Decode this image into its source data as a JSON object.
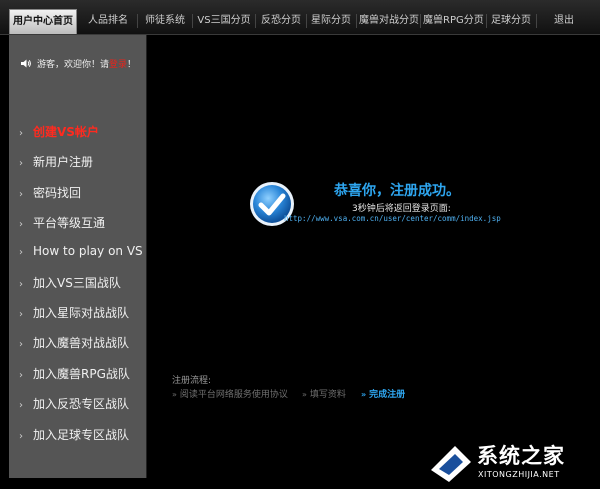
{
  "nav": {
    "tabs": [
      {
        "label": "用户中心首页",
        "active": true
      },
      {
        "label": "人品排名"
      },
      {
        "label": "师徒系统"
      },
      {
        "label": "VS三国分页"
      },
      {
        "label": "反恐分页"
      },
      {
        "label": "星际分页"
      },
      {
        "label": "魔兽对战分页"
      },
      {
        "label": "魔兽RPG分页"
      },
      {
        "label": "足球分页"
      },
      {
        "label": "退出"
      }
    ]
  },
  "sidebar": {
    "welcome_prefix": "游客，欢迎你！请",
    "welcome_link": "登录",
    "welcome_suffix": "！",
    "items": [
      {
        "label": "创建VS帐户",
        "active": true
      },
      {
        "label": "新用户注册"
      },
      {
        "label": "密码找回"
      },
      {
        "label": "平台等级互通"
      },
      {
        "label": "How to play on VS"
      },
      {
        "label": "加入VS三国战队"
      },
      {
        "label": "加入星际对战战队"
      },
      {
        "label": "加入魔兽对战战队"
      },
      {
        "label": "加入魔兽RPG战队"
      },
      {
        "label": "加入反恐专区战队"
      },
      {
        "label": "加入足球专区战队"
      }
    ]
  },
  "message": {
    "title": "恭喜你，注册成功。",
    "redirect_text": "3秒钟后将返回登录页面:",
    "redirect_url": "http://www.vsa.com.cn/user/center/comm/index.jsp"
  },
  "process": {
    "title": "注册流程:",
    "steps": [
      {
        "label": "阅读平台网络服务使用协议",
        "status": "done"
      },
      {
        "label": "填写资料",
        "status": "done"
      },
      {
        "label": "完成注册",
        "status": "current"
      }
    ]
  },
  "watermark": {
    "cn": "系统之家",
    "en": "XITONGZHIJIA.NET"
  },
  "colors": {
    "accent_blue": "#2ea6f0",
    "active_red": "#ff2a1f",
    "sidebar_bg": "#555555"
  }
}
